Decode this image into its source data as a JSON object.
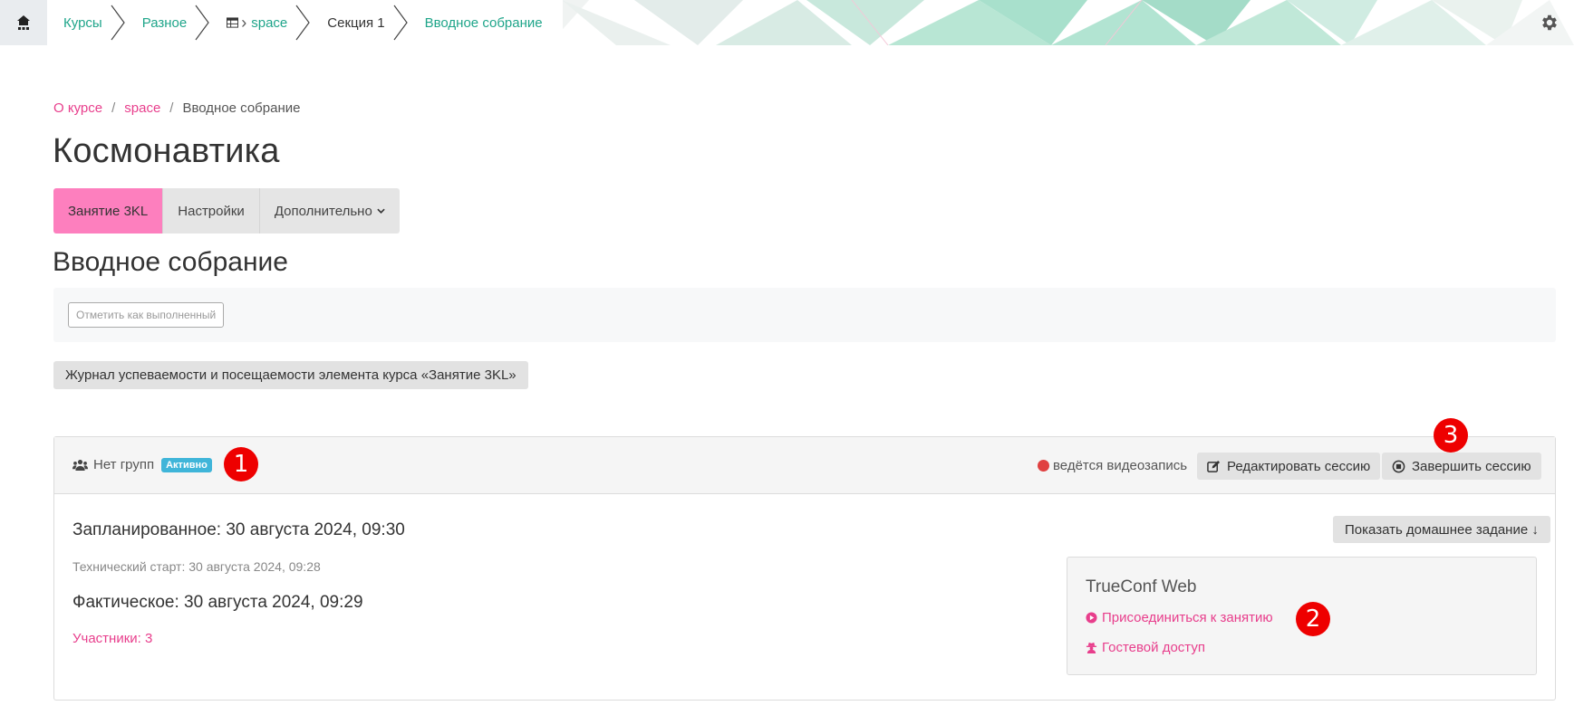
{
  "topbar": {
    "crumbs": [
      {
        "label": "Курсы",
        "style": "link"
      },
      {
        "label": "Разное",
        "style": "link"
      },
      {
        "label": "space",
        "style": "link"
      },
      {
        "label": "Секция 1",
        "style": "plain"
      },
      {
        "label": "Вводное собрание",
        "style": "link"
      }
    ],
    "icons": {
      "home": "home-icon",
      "table": "table-icon",
      "settings": "gear-icon"
    }
  },
  "breadcrumb": {
    "items": [
      "О курсе",
      "space",
      "Вводное собрание"
    ],
    "separator": "/"
  },
  "page_title": "Космонавтика",
  "tabs": [
    {
      "label": "Занятие 3KL",
      "active": true
    },
    {
      "label": "Настройки",
      "active": false
    },
    {
      "label": "Дополнительно",
      "active": false
    }
  ],
  "section_title": "Вводное собрание",
  "completion_button": "Отметить как выполненный",
  "journal_button": "Журнал успеваемости и посещаемости элемента курса «Занятие 3KL»",
  "session": {
    "groups_label": "Нет групп",
    "badge": "Активно",
    "recording_label": "ведётся видеозапись",
    "edit_button": "Редактировать сессию",
    "end_button": "Завершить сессию",
    "scheduled": "Запланированное: 30 августа 2024, 09:30",
    "technical_start": "Технический старт: 30 августа 2024, 09:28",
    "actual": "Фактическое: 30 августа 2024, 09:29",
    "participants": "Участники: 3",
    "homework_button": "Показать домашнее задание ↓",
    "trueconf": {
      "title": "TrueConf Web",
      "join_link": "Присоединиться к занятию",
      "guest_link": "Гостевой доступ"
    }
  },
  "markers": [
    "1",
    "2",
    "3"
  ],
  "colors": {
    "accent_pink": "#e83e8c",
    "tab_active": "#fd7fbe",
    "link_teal": "#1fa58a",
    "badge_blue": "#3fb5d9",
    "marker_red": "#ee0000"
  }
}
